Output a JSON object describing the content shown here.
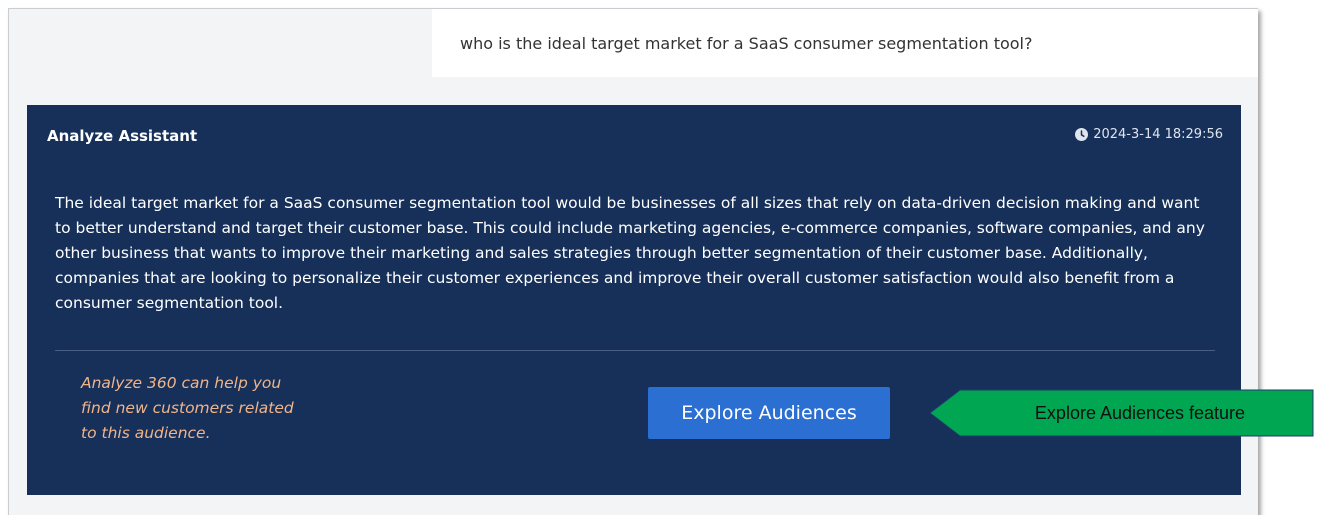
{
  "chat": {
    "user_message": "who is the ideal target market for a SaaS consumer segmentation tool?",
    "assistant": {
      "name": "Analyze Assistant",
      "timestamp": "2024-3-14 18:29:56",
      "answer": "The ideal target market for a SaaS consumer segmentation tool would be businesses of all sizes that rely on data-driven decision making and want to better understand and target their customer base. This could include marketing agencies, e-commerce companies, software companies, and any other business that wants to improve their marketing and sales strategies through better segmentation of their customer base. Additionally, companies that are looking to personalize their customer experiences and improve their overall customer satisfaction would also benefit from a consumer segmentation tool.",
      "promo_text": "Analyze 360 can help you find new customers related to this audience.",
      "explore_button_label": "Explore Audiences"
    }
  },
  "annotation": {
    "callout_label": "Explore Audiences feature",
    "callout_color": "#00a651"
  },
  "colors": {
    "panel_background": "#16305a",
    "button_background": "#2a6fd1",
    "promo_text": "#f0b48a"
  },
  "icons": {
    "timestamp_icon": "clock-icon"
  }
}
